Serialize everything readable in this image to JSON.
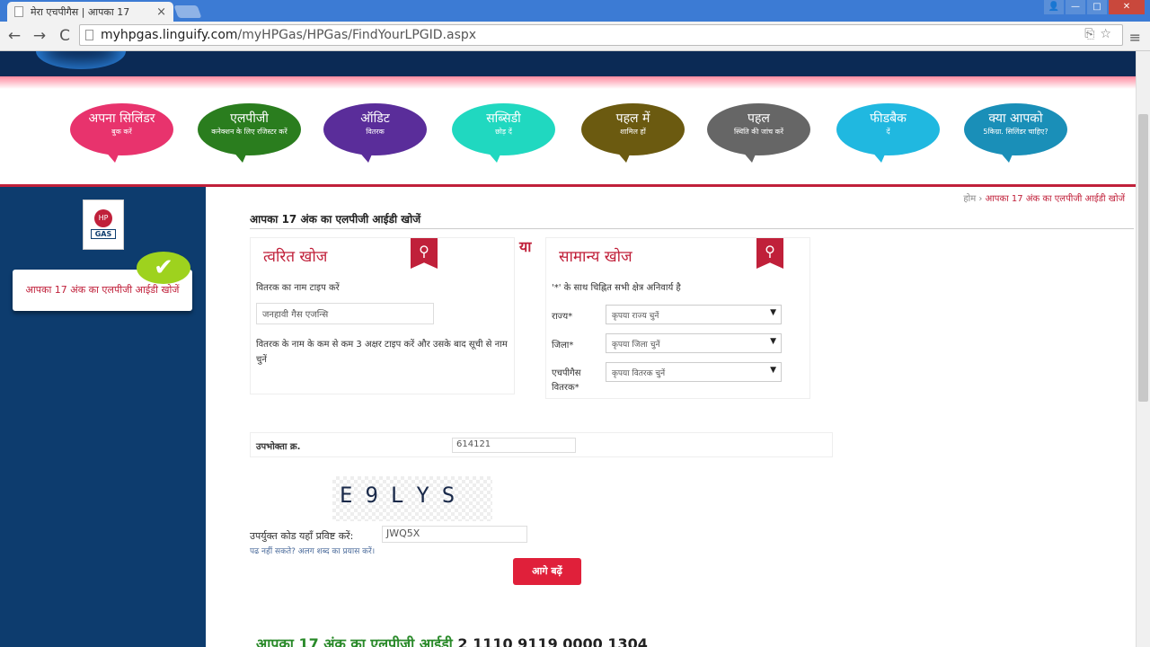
{
  "browser": {
    "tab_title": "मेरा एचपीगैस | आपका 17",
    "tab_close": "×",
    "url_host": "myhpgas.linguify.com",
    "url_path": "/myHPGas/HPGas/FindYourLPGID.aspx",
    "back": "←",
    "forward": "→",
    "reload": "C",
    "menu": "≡",
    "win_user": "👤",
    "win_min": "—",
    "win_max": "□",
    "win_close": "✕"
  },
  "nav_bubbles": [
    {
      "title": "अपना सिलिंडर",
      "sub": "बुक करें",
      "color": "#e8336d"
    },
    {
      "title": "एलपीजी",
      "sub": "कनेक्शन के लिए रजिस्टर करें",
      "color": "#2a7d1e"
    },
    {
      "title": "ऑडिट",
      "sub": "वितरक",
      "color": "#5a2d9a"
    },
    {
      "title": "सब्सिडी",
      "sub": "छोड़ दें",
      "color": "#20d8c0"
    },
    {
      "title": "पहल में",
      "sub": "शामिल हों",
      "color": "#6b5a10"
    },
    {
      "title": "पहल",
      "sub": "स्थिति की जांच करें",
      "color": "#666666"
    },
    {
      "title": "फीडबैक",
      "sub": "दें",
      "color": "#20b8e0"
    },
    {
      "title": "क्या आपको",
      "sub": "5किग्रा. सिलिंडर चाहिए?",
      "color": "#1a8fb8"
    }
  ],
  "sidebar": {
    "logo_hp": "HP",
    "logo_gas": "GAS",
    "card_label": "आपका 17 अंक का एलपीजी आईडी खोजें"
  },
  "breadcrumb": {
    "home": "होम",
    "sep": "›",
    "current": "आपका 17 अंक का एलपीजी आईडी खोजें"
  },
  "page_title": "आपका 17 अंक का एलपीजी आईडी खोजें",
  "quick_search": {
    "heading": "त्वरित खोज",
    "label": "वितरक का नाम टाइप करें",
    "value": "जनहावी गैस एजन्सि",
    "hint": "वितरक के नाम के कम से कम 3 अक्षर टाइप करें और उसके बाद सूची से नाम चुनें"
  },
  "or_label": "या",
  "general_search": {
    "heading": "सामान्य खोज",
    "note": "'*' के साथ चिह्नित सभी क्षेत्र अनिवार्य है",
    "state_label": "राज्य*",
    "state_value": "कृपया राज्य चुनें",
    "district_label": "जिला*",
    "district_value": "कृपया जिला चुनें",
    "distributor_label": "एचपीगैस वितरक*",
    "distributor_value": "कृपया वितरक चुनें"
  },
  "consumer": {
    "label": "उपभोक्ता क्र.",
    "value": "614121"
  },
  "captcha": {
    "text": "E9LYS",
    "label": "उपर्युक्त कोड यहाँ प्रविष्ट करें:",
    "value": "JWQ5X",
    "help": "पढ नहीं सकते? अलग शब्द का प्रयास करें।"
  },
  "submit_label": "आगे बढ़ें",
  "result": {
    "label": "आपका 17 अंक का एलपीजी आईडी",
    "number": "2 1110 9119 0000 1304"
  }
}
